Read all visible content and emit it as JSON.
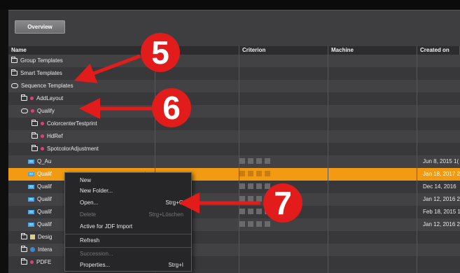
{
  "toolbar": {
    "tab_label": "Overview"
  },
  "columns": {
    "name": "Name",
    "criterion": "Criterion",
    "machine": "Machine",
    "created_on": "Created on"
  },
  "rows": [
    {
      "label": "Group Templates",
      "date": ""
    },
    {
      "label": "Smart Templates",
      "date": ""
    },
    {
      "label": "Sequence Templates",
      "date": ""
    },
    {
      "label": "AddLayout",
      "date": ""
    },
    {
      "label": "Qualify",
      "date": ""
    },
    {
      "label": "ColorcenterTestprint",
      "date": ""
    },
    {
      "label": "HdRef",
      "date": ""
    },
    {
      "label": "SpotcolorAdjustment",
      "date": ""
    },
    {
      "label": "Q_Au",
      "date": "Jun 8, 2015 1("
    },
    {
      "label": "Qualif",
      "date": "Jan 18, 2017 2"
    },
    {
      "label": "Qualif",
      "date": "Dec 14, 2016"
    },
    {
      "label": "Qualif",
      "date": "Jan 12, 2016 2"
    },
    {
      "label": "Qualif",
      "date": "Feb 18, 2015 1"
    },
    {
      "label": "Qualif",
      "date": "Jan 12, 2016 2"
    },
    {
      "label": "Desig",
      "date": ""
    },
    {
      "label": "Intera",
      "date": ""
    },
    {
      "label": "PDFE",
      "date": ""
    }
  ],
  "context_menu": {
    "new": "New",
    "new_folder": "New Folder...",
    "open": "Open...",
    "open_shortcut": "Strg+O",
    "delete": "Delete",
    "delete_shortcut": "Strg+Löschen",
    "active_jdf": "Active for JDF Import",
    "refresh": "Refresh",
    "succession": "Succession...",
    "properties": "Properties...",
    "properties_shortcut": "Strg+I"
  },
  "markers": {
    "m5": "5",
    "m6": "6",
    "m7": "7"
  },
  "colors": {
    "selected_row": "#f29b12",
    "marker": "#e21b1b"
  }
}
